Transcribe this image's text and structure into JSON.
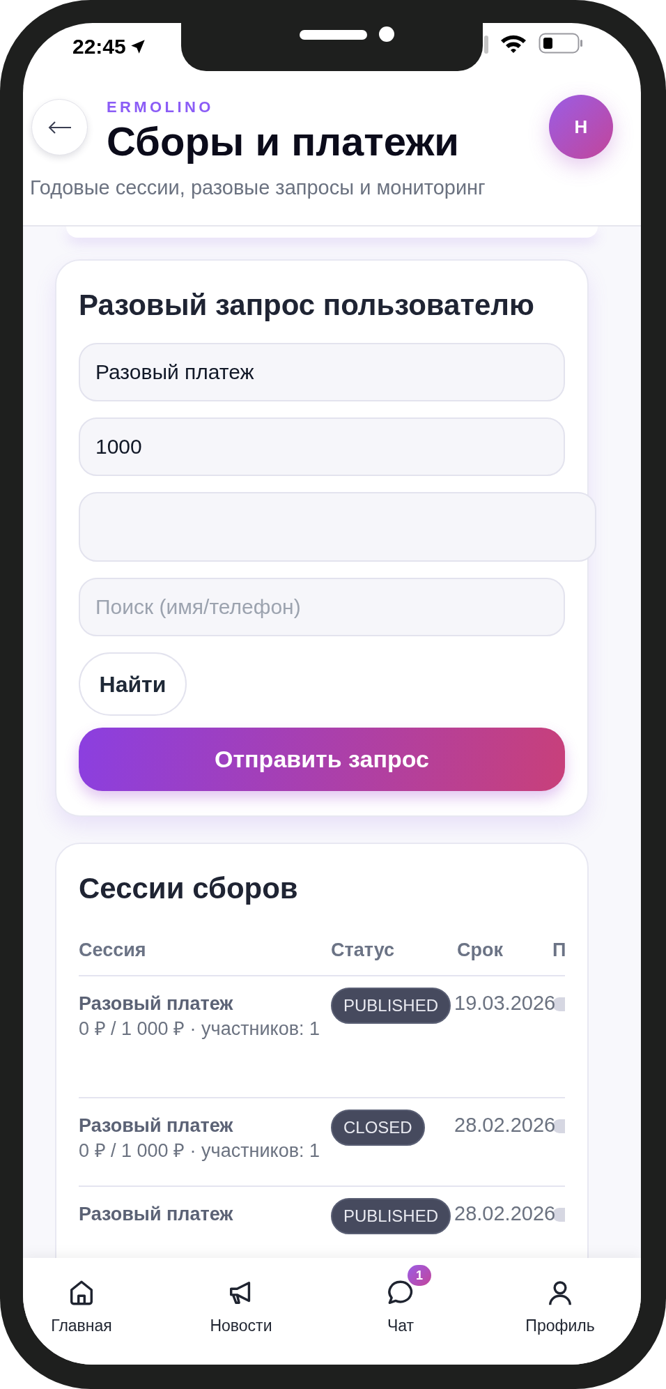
{
  "status_bar": {
    "time": "22:45"
  },
  "header": {
    "brand": "ERMOLINO",
    "title": "Сборы и платежи",
    "subtitle": "Годовые сессии, разовые запросы и мониторинг",
    "avatar": "Н"
  },
  "request_form": {
    "title": "Разовый запрос пользователю",
    "fields": [
      {
        "kind": "text",
        "value": "Разовый платеж"
      },
      {
        "kind": "text",
        "value": "1000"
      },
      {
        "kind": "textarea"
      },
      {
        "kind": "search",
        "placeholder": "Поиск (имя/телефон)"
      }
    ],
    "find_button": "Найти",
    "submit_button": "Отправить запрос"
  },
  "sessions": {
    "title": "Сессии сборов",
    "columns": [
      "Сессия",
      "Статус",
      "Срок",
      "П"
    ],
    "rows": [
      {
        "name": "Разовый платеж",
        "summary": "0 ₽ / 1 000 ₽ · участников: 1",
        "status": "PUBLISHED",
        "deadline": "19.03.2026"
      },
      {
        "name": "Разовый платеж",
        "summary": "0 ₽ / 1 000 ₽ · участников: 1",
        "status": "CLOSED",
        "deadline": "28.02.2026"
      },
      {
        "name": "Разовый платеж",
        "status": "PUBLISHED",
        "deadline": "28.02.2026"
      }
    ]
  },
  "nav": [
    {
      "kind": "home",
      "label": "Главная"
    },
    {
      "kind": "news",
      "label": "Новости"
    },
    {
      "kind": "chat",
      "label": "Чат",
      "badge": "1"
    },
    {
      "kind": "profile",
      "label": "Профиль"
    }
  ]
}
